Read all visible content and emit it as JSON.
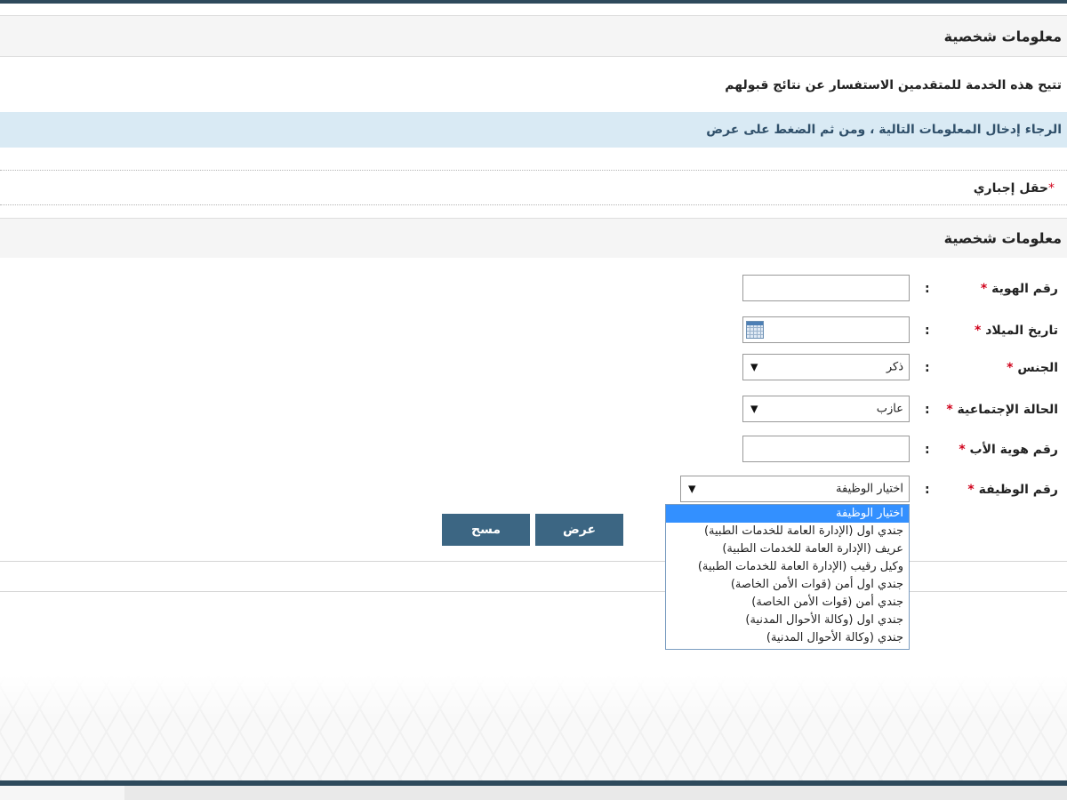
{
  "sections": {
    "main_title": "معلومات شخصية",
    "form_title": "معلومات شخصية"
  },
  "description": "تتيح هذه الخدمة للمتقدمين الاستفسار عن نتائج قبولهم",
  "instruction": "الرجاء إدخال المعلومات التالية ، ومن ثم الضغط على عرض",
  "mandatory_note": {
    "star": "*",
    "text": "حقل إجباري"
  },
  "form": {
    "colon": ":",
    "star": "*",
    "id_number": {
      "label": "رقم الهوية",
      "value": ""
    },
    "birth_date": {
      "label": "تاريخ الميلاد",
      "value": ""
    },
    "gender": {
      "label": "الجنس",
      "selected": "ذكر"
    },
    "marital_status": {
      "label": "الحالة الإجتماعية",
      "selected": "عازب"
    },
    "father_id": {
      "label": "رقم هوية الأب",
      "value": ""
    },
    "job_number": {
      "label": "رقم الوظيفة",
      "selected": "اختيار الوظيفة",
      "options": [
        "اختيار الوظيفة",
        "جندي اول (الإدارة العامة للخدمات الطبية)",
        "عريف (الإدارة العامة للخدمات الطبية)",
        "وكيل رقيب (الإدارة العامة للخدمات الطبية)",
        "جندي اول أمن (قوات الأمن الخاصة)",
        "جندي أمن (قوات الأمن الخاصة)",
        "جندي اول (وكالة الأحوال المدنية)",
        "جندي (وكالة الأحوال المدنية)"
      ]
    }
  },
  "buttons": {
    "show": "عرض",
    "clear": "مسح"
  },
  "icons": {
    "select_arrow": "▼",
    "calendar": "calendar-icon"
  },
  "colors": {
    "header_bar": "#2e4a5c",
    "button": "#3c6683",
    "info_band": "#d9eaf4",
    "required": "#d0021b",
    "selected_option": "#3390ff"
  }
}
